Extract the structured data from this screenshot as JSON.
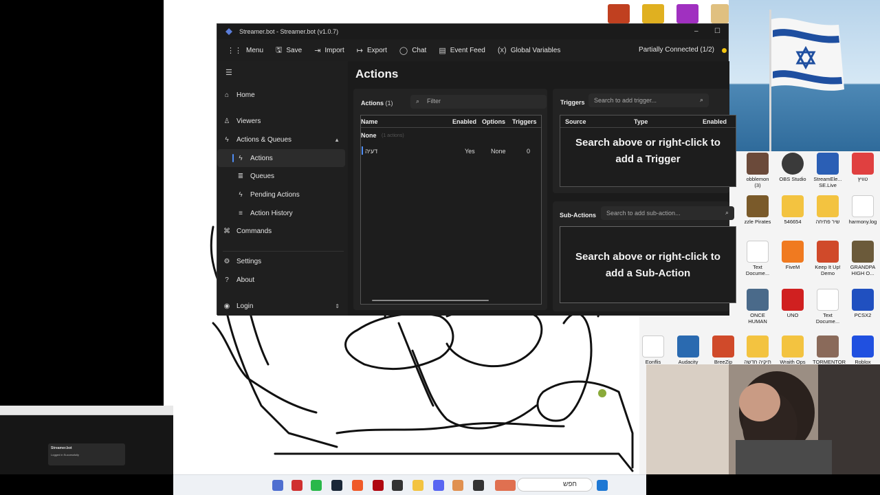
{
  "window": {
    "title": "Streamer.bot - Streamer.bot (v1.0.7)"
  },
  "menu": {
    "menu": "Menu",
    "save": "Save",
    "import": "Import",
    "export": "Export",
    "chat": "Chat",
    "event_feed": "Event Feed",
    "global_variables": "Global Variables",
    "status": "Partially Connected (1/2)"
  },
  "sidebar": {
    "home": "Home",
    "viewers": "Viewers",
    "actions_queues": "Actions & Queues",
    "actions": "Actions",
    "queues": "Queues",
    "pending_actions": "Pending Actions",
    "action_history": "Action History",
    "commands": "Commands",
    "settings": "Settings",
    "about": "About",
    "login": "Login"
  },
  "page": {
    "title": "Actions"
  },
  "actions_panel": {
    "title": "Actions",
    "count": "(1)",
    "filter_placeholder": "Filter",
    "columns": [
      "Name",
      "Enabled",
      "Options",
      "Triggers"
    ],
    "group": {
      "name": "None",
      "count": "(1 actions)"
    },
    "rows": [
      {
        "name": "דעיה",
        "enabled": "Yes",
        "options": "None",
        "triggers": "0"
      }
    ]
  },
  "triggers_panel": {
    "title": "Triggers",
    "search_placeholder": "Search to add trigger...",
    "columns": [
      "Source",
      "Type",
      "Enabled"
    ],
    "empty_line1": "Search above or right-click to",
    "empty_line2": "add a Trigger"
  },
  "subactions_panel": {
    "title": "Sub-Actions",
    "search_placeholder": "Search to add sub-action...",
    "empty_line1": "Search above or right-click to",
    "empty_line2": "add a Sub-Action"
  },
  "desktop": {
    "icons": [
      {
        "label": "obblemon (3)",
        "color": "#6b4a3a"
      },
      {
        "label": "OBS Studio",
        "color": "#3a3a3a"
      },
      {
        "label": "StreamEle... SE.Live",
        "color": "#2b5fb5"
      },
      {
        "label": "טוויץ",
        "color": "#e04040"
      },
      {
        "label": "zzle Pirates",
        "color": "#7a5a2a"
      },
      {
        "label": "546654",
        "color": "#f3c340"
      },
      {
        "label": "שיר פתיחה",
        "color": "#f3c340"
      },
      {
        "label": "harmony.log",
        "color": "#ffffff"
      },
      {
        "label": "Text Docume...",
        "color": "#ffffff"
      },
      {
        "label": "FiveM",
        "color": "#f07a20"
      },
      {
        "label": "Keep It Up! Demo",
        "color": "#d04a2a"
      },
      {
        "label": "GRANDPA HIGH O...",
        "color": "#6b5a3a"
      },
      {
        "label": "ONCE HUMAN",
        "color": "#4a6a8a"
      },
      {
        "label": "UNO",
        "color": "#d02020"
      },
      {
        "label": "Text Docume...",
        "color": "#ffffff"
      },
      {
        "label": "PCSX2",
        "color": "#2050c0"
      },
      {
        "label": "Eonflis",
        "color": "#ffffff"
      },
      {
        "label": "Audacity",
        "color": "#2a6ab0"
      },
      {
        "label": "BreeZip",
        "color": "#d04a2a"
      },
      {
        "label": "תיקיה חדשה",
        "color": "#f3c340"
      },
      {
        "label": "Wraith Ops",
        "color": "#f3c340"
      },
      {
        "label": "TORMENTOR",
        "color": "#8a6a5a"
      },
      {
        "label": "Roblox Player",
        "color": "#2050e0"
      }
    ]
  },
  "notification": {
    "title": "Streamer.bot",
    "message": "Logged in Successfully"
  },
  "taskbar": {
    "search_placeholder": "חפש"
  }
}
